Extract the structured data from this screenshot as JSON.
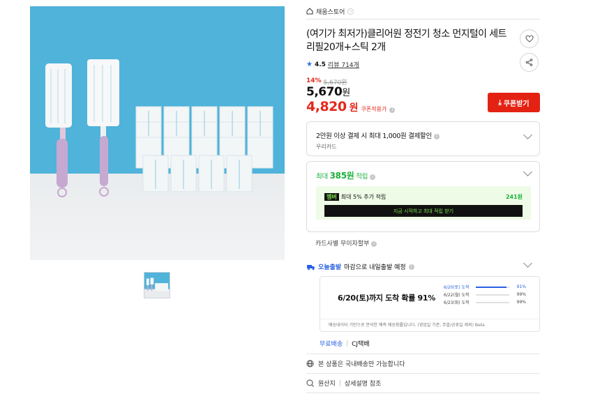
{
  "breadcrumb": {
    "store": "채움스토어"
  },
  "product": {
    "title": "(여기가 최저가)클리어원 정전기 청소 먼지털이 세트 리필20개+스틱 2개",
    "rating": "4.5",
    "review_link": "리뷰 714개"
  },
  "price": {
    "discount_pct": "14%",
    "original": "5,670원",
    "sale": "5,670",
    "sale_unit": "원",
    "coupon": "4,820",
    "coupon_unit": "원",
    "coupon_label": "쿠폰적용가",
    "coupon_button": "쿠폰받기"
  },
  "card_promo": {
    "line": "2만원 이상 결제 시 최대 1,000원 결제할인",
    "card": "우리카드"
  },
  "points": {
    "prefix": "최대",
    "amount": "385원",
    "suffix": "적립",
    "member_badge": "멤버",
    "member_text": "최대 5% 추가 적립",
    "member_amount": "241원",
    "cta": "지금 시작하고 최대 적립 받기"
  },
  "card_free": "카드사별 무이자할부",
  "shipping": {
    "today_label": "오늘출발",
    "deadline": "마감으로 내일출발 예정",
    "headline": "6/20(토)까지 도착 확률 91%",
    "rows": [
      {
        "date": "6/20(토) 도착",
        "pct": "91%",
        "value": 0.91
      },
      {
        "date": "6/22(월) 도착",
        "pct": "99%",
        "value": 0.99
      },
      {
        "date": "6/23(화) 도착",
        "pct": "99%",
        "value": 0.99
      }
    ],
    "note": "배송데이터 기반으로 분석한 예측 배송확률입니다. (영업일 기준, 주말/공휴일 제외) Beta",
    "free": "무료배송",
    "courier": "CJ택배"
  },
  "footer": {
    "domestic": "본 상품은 국내배송만 가능합니다",
    "origin": "원산지",
    "origin_value": "상세설명 참조"
  },
  "colors": {
    "accent_red": "#e42214",
    "point_green": "#1bb13c",
    "ship_blue": "#2860e1"
  }
}
